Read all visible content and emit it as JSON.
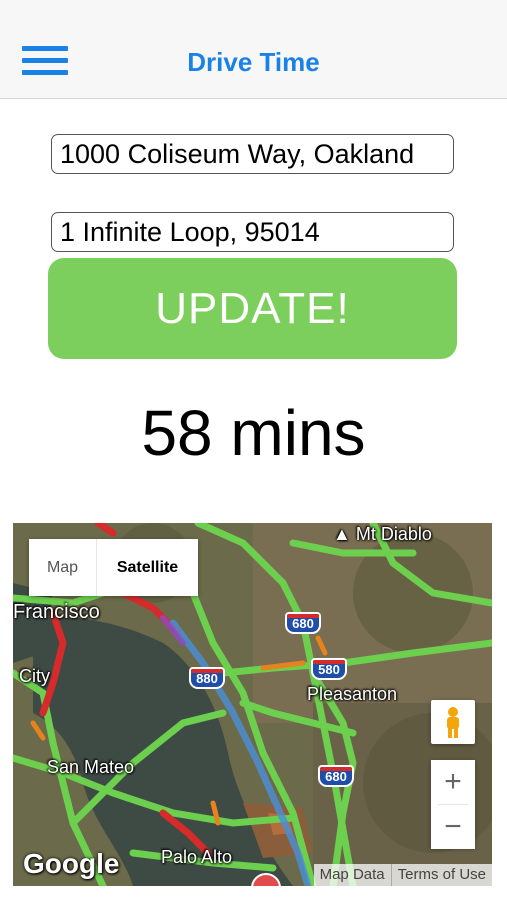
{
  "navbar": {
    "title": "Drive Time",
    "menu_icon": "hamburger-menu-icon",
    "accent_color": "#1a82e6"
  },
  "form": {
    "origin_value": "1000 Coliseum Way, Oakland",
    "destination_value": "1 Infinite Loop, 95014",
    "update_label": "UPDATE!",
    "update_color": "#7ccf5c"
  },
  "result": {
    "drive_time": "58 mins"
  },
  "map": {
    "type_control": {
      "map_label": "Map",
      "satellite_label": "Satellite",
      "selected": "Satellite"
    },
    "labels": {
      "mt_diablo": "Mt Diablo",
      "san_francisco": "Francisco",
      "daly_city": "City",
      "pleasanton": "Pleasanton",
      "san_mateo": "San Mateo",
      "palo_alto": "Palo Alto"
    },
    "shields": {
      "i680_north": "680",
      "i580": "580",
      "i880": "880",
      "i680_south": "680"
    },
    "zoom_in": "+",
    "zoom_out": "−",
    "logo": "Google",
    "attribution": {
      "map_data": "Map Data",
      "terms": "Terms of Use"
    },
    "pegman_icon": "pegman-icon"
  }
}
